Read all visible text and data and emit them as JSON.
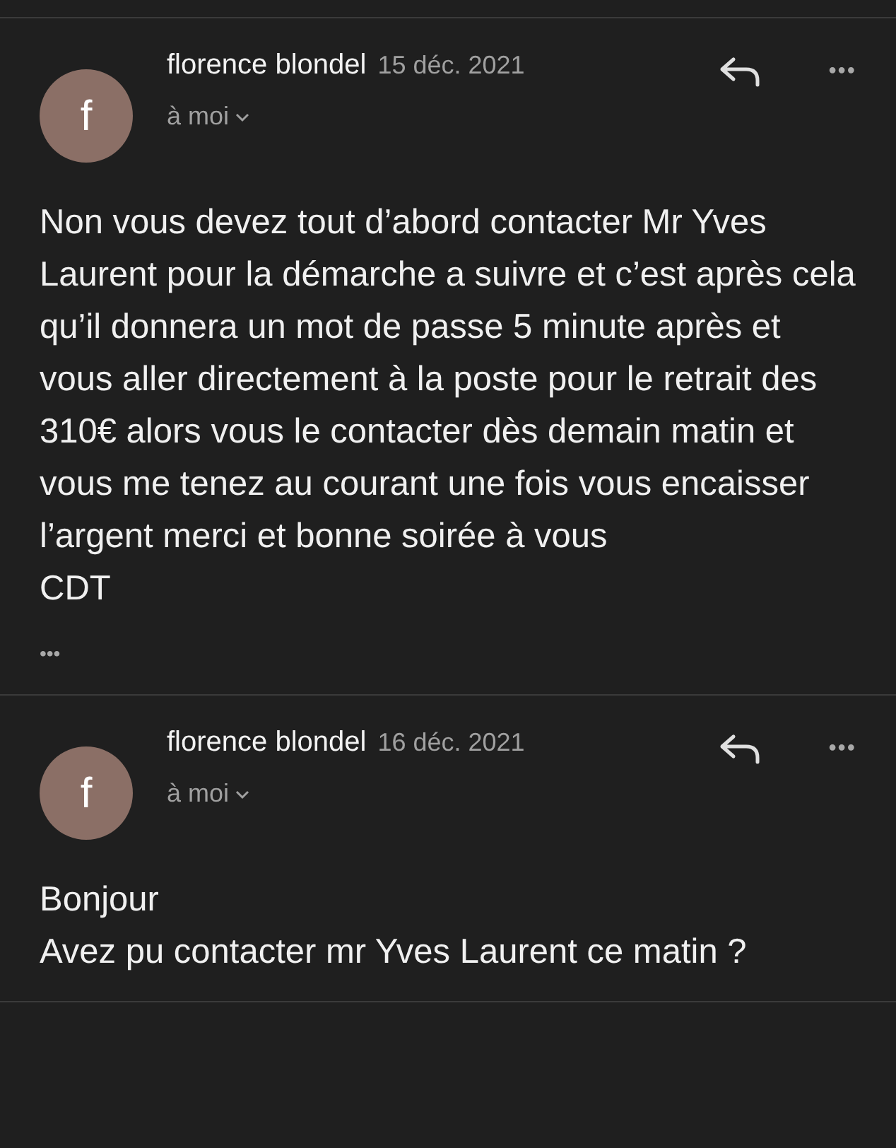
{
  "messages": [
    {
      "avatar_letter": "f",
      "sender": "florence blondel",
      "date": "15 déc. 2021",
      "recipient": "à moi",
      "more": "•••",
      "body": [
        "Non vous devez tout d’abord contacter Mr Yves Laurent pour la démarche a suivre et c’est après cela qu’il donnera un mot de passe 5 minute après et vous aller directement à la poste pour le retrait des 310€ alors vous le contacter dès demain matin et vous me tenez au courant une fois vous encaisser l’argent merci et bonne soirée à vous",
        "CDT"
      ],
      "trimmed": "•••"
    },
    {
      "avatar_letter": "f",
      "sender": "florence blondel",
      "date": "16 déc. 2021",
      "recipient": "à moi",
      "more": "•••",
      "body": [
        "Bonjour",
        "Avez pu contacter mr Yves Laurent ce matin ?"
      ]
    }
  ]
}
